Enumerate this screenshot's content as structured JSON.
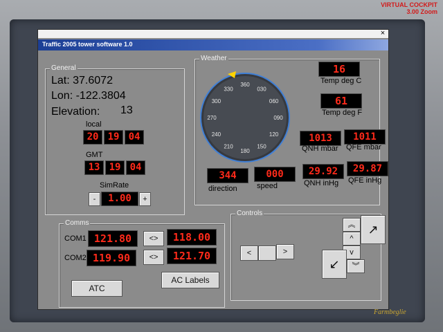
{
  "overlay": {
    "vc_line1": "VIRTUAL COCKPIT",
    "vc_line2": "3.00 Zoom",
    "credit": "Farmbeglie"
  },
  "window": {
    "close": "×",
    "title": "Traffic 2005 tower software 1.0"
  },
  "general": {
    "label": "General",
    "lat": "Lat: 37.6072",
    "lon": "Lon: -122.3804",
    "elevation_label": "Elevation:",
    "elevation_value": "13",
    "local_label": "local",
    "local": [
      "20",
      "19",
      "04"
    ],
    "gmt_label": "GMT",
    "gmt": [
      "13",
      "19",
      "04"
    ],
    "simrate_label": "SimRate",
    "simrate_value": "1.00",
    "minus": "-",
    "plus": "+"
  },
  "weather": {
    "label": "Weather",
    "compass_ticks": [
      "360",
      "030",
      "060",
      "090",
      "120",
      "150",
      "180",
      "210",
      "240",
      "270",
      "300",
      "330"
    ],
    "temp_c": "16",
    "temp_c_label": "Temp deg C",
    "temp_f": "61",
    "temp_f_label": "Temp deg F",
    "qnh_mbar": "1013",
    "qnh_mbar_label": "QNH mbar",
    "qfe_mbar": "1011",
    "qfe_mbar_label": "QFE mbar",
    "direction": "344",
    "direction_label": "direction",
    "speed": "000",
    "speed_label": "speed",
    "qnh_inhg": "29.92",
    "qnh_inhg_label": "QNH inHg",
    "qfe_inhg": "29.87",
    "qfe_inhg_label": "QFE inHg"
  },
  "comms": {
    "label": "Comms",
    "com1_label": "COM1",
    "com1_active": "121.80",
    "com1_standby": "118.00",
    "com2_label": "COM2",
    "com2_active": "119.90",
    "com2_standby": "121.70",
    "swap": "<>",
    "atc_button": "ATC",
    "ac_labels_button": "AC Labels"
  },
  "controls": {
    "label": "Controls",
    "left": "<",
    "right": ">",
    "double_up": "︽",
    "up": "^",
    "down": "v",
    "double_down": "︾",
    "up_right": "↗",
    "down_left": "↙"
  }
}
